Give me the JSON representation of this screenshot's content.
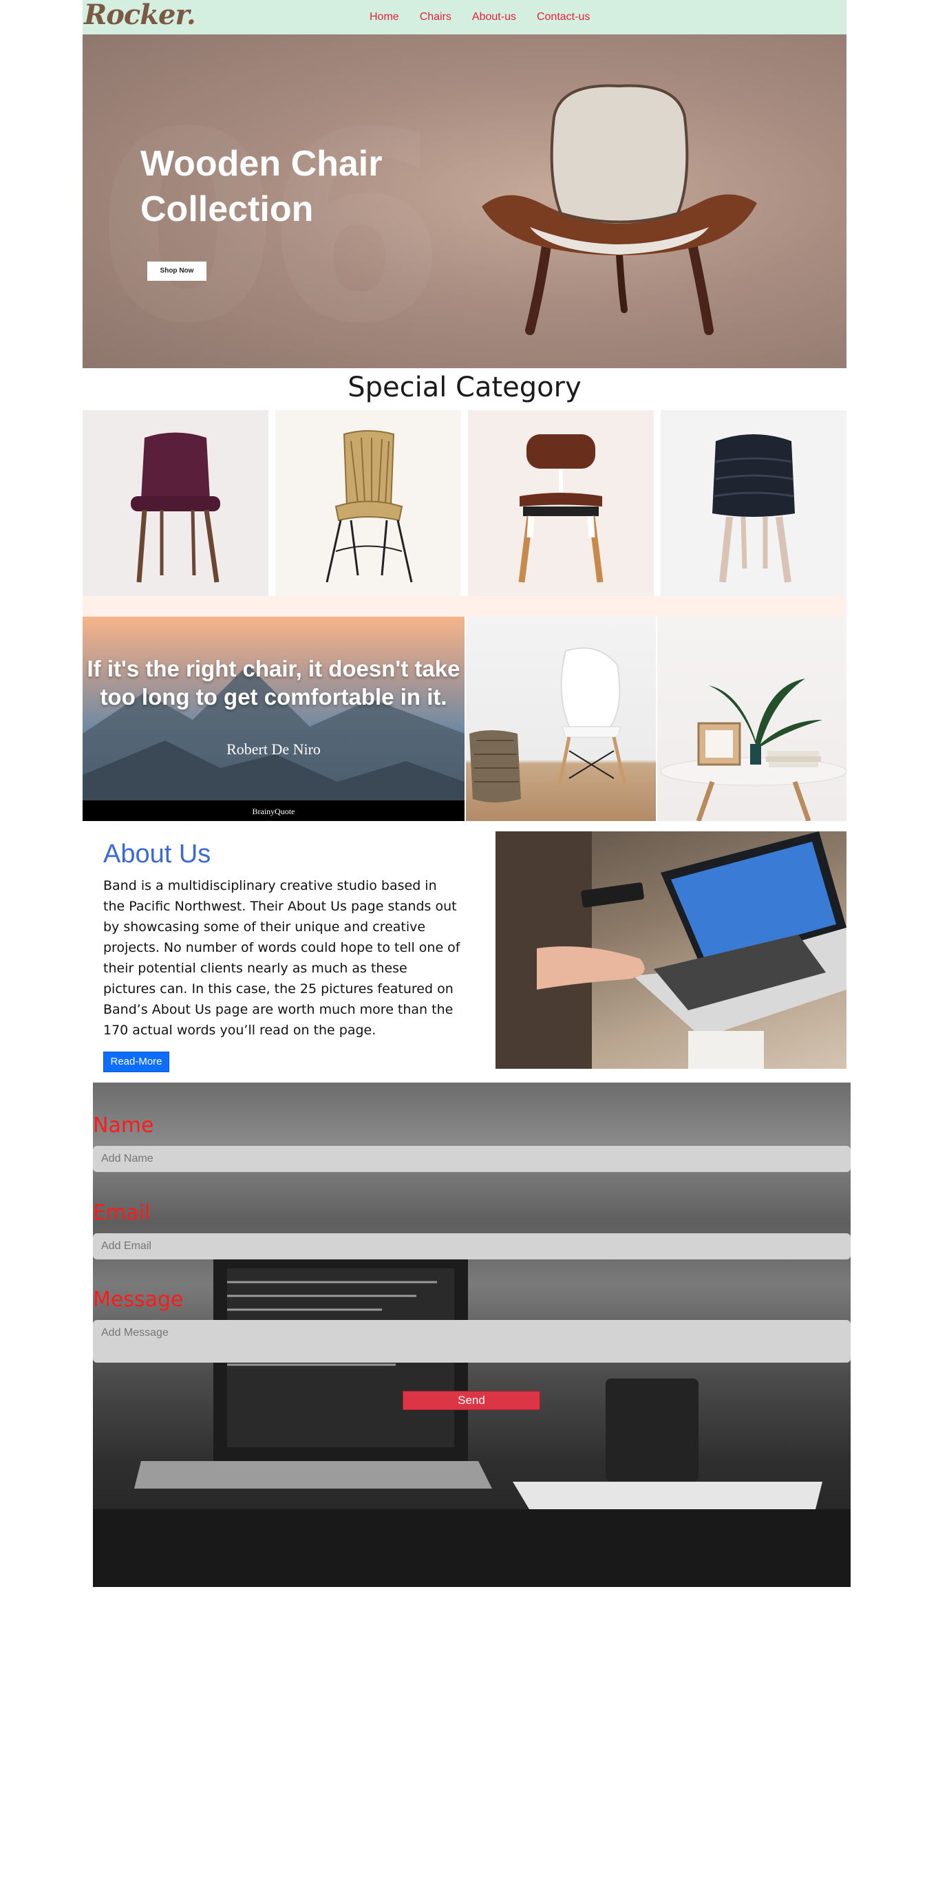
{
  "nav": {
    "brand": "Rocker",
    "brand_dot": ".",
    "links": [
      "Home",
      "Chairs",
      "About-us",
      "Contact-us"
    ]
  },
  "hero": {
    "bg_number": "06",
    "title": "Wooden Chair Collection",
    "cta_label": "Shop Now"
  },
  "special": {
    "title": "Special Category",
    "items": [
      {
        "name": "plum-chair",
        "bg": "#f1ecec"
      },
      {
        "name": "rattan-chair",
        "bg": "#f8f5f1"
      },
      {
        "name": "leather-chair",
        "bg": "#f6eeeb"
      },
      {
        "name": "black-chair",
        "bg": "#f3f3f3"
      }
    ]
  },
  "quote": {
    "text": "If it's the right chair, it doesn't take too long to get comfortable in it.",
    "author": "Robert De Niro",
    "source": "BrainyQuote"
  },
  "about": {
    "title": "About Us",
    "body": "Band is a multidisciplinary creative studio based in the Pacific Northwest. Their About Us page stands out by showcasing some of their unique and creative projects. No number of words could hope to tell one of their potential clients nearly as much as these pictures can. In this case, the 25 pictures featured on Band’s About Us page are worth much more than the 170 actual words you’ll read on the page.",
    "button": "Read-More"
  },
  "contact": {
    "name_label": "Name",
    "name_placeholder": "Add Name",
    "email_label": "Email",
    "email_placeholder": "Add Email",
    "message_label": "Message",
    "message_placeholder": "Add Message",
    "send_label": "Send"
  },
  "colors": {
    "nav_bg": "#d4efe0",
    "nav_link": "#e0223a",
    "about_title": "#3a6ad6",
    "label_red": "#ff1a1a",
    "send_btn": "#dc3545",
    "read_more": "#0d6efd"
  }
}
